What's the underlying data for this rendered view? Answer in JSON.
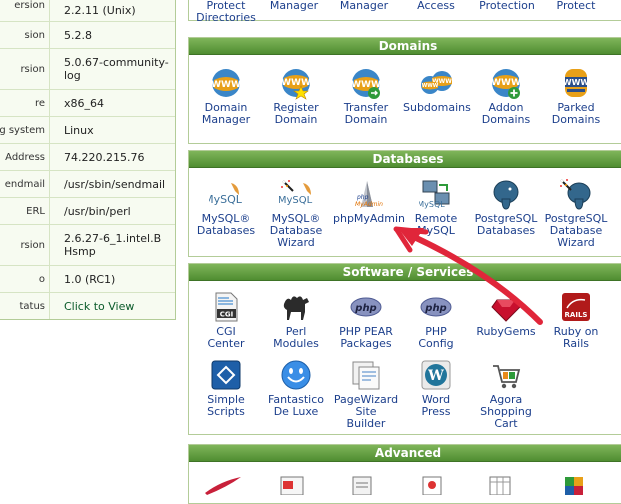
{
  "stats": [
    {
      "label": "ersion",
      "value": "2.2.11 (Unix)"
    },
    {
      "label": "sion",
      "value": "5.2.8"
    },
    {
      "label": "rsion",
      "value": "5.0.67-community-log"
    },
    {
      "label": "re",
      "value": "x86_64"
    },
    {
      "label": "g system",
      "value": "Linux"
    },
    {
      "label": "Address",
      "value": "74.220.215.76"
    },
    {
      "label": "endmail",
      "value": "/usr/sbin/sendmail"
    },
    {
      "label": "ERL",
      "value": "/usr/bin/perl"
    },
    {
      "label": "rsion",
      "value": "2.6.27-6_1.intel.BHsmp"
    },
    {
      "label": "o",
      "value": "1.0 (RC1)"
    },
    {
      "label": "tatus",
      "value": "Click to View"
    }
  ],
  "top_partial": [
    {
      "text": "Protect\nDirectories"
    },
    {
      "text": "Manager"
    },
    {
      "text": "Manager"
    },
    {
      "text": "Access"
    },
    {
      "text": "Protection"
    },
    {
      "text": "Protect"
    }
  ],
  "domains": {
    "title": "Domains",
    "items": [
      {
        "label": "Domain\nManager",
        "icon": "www-globe-icon"
      },
      {
        "label": "Register\nDomain",
        "icon": "www-star-icon"
      },
      {
        "label": "Transfer\nDomain",
        "icon": "www-transfer-icon"
      },
      {
        "label": "Subdomains",
        "icon": "www-sub-icon"
      },
      {
        "label": "Addon\nDomains",
        "icon": "www-add-icon"
      },
      {
        "label": "Parked\nDomains",
        "icon": "www-parked-icon"
      }
    ]
  },
  "databases": {
    "title": "Databases",
    "items": [
      {
        "label": "MySQL®\nDatabases",
        "icon": "mysql-dolphin-icon"
      },
      {
        "label": "MySQL®\nDatabase\nWizard",
        "icon": "mysql-wizard-icon"
      },
      {
        "label": "phpMyAdmin",
        "icon": "phpmyadmin-icon",
        "logo": "php\nMyAdmin"
      },
      {
        "label": "Remote\nMySQL",
        "icon": "remote-mysql-icon"
      },
      {
        "label": "PostgreSQL\nDatabases",
        "icon": "postgresql-elephant-icon"
      },
      {
        "label": "PostgreSQL\nDatabase\nWizard",
        "icon": "postgresql-wizard-icon"
      }
    ]
  },
  "software": {
    "title": "Software / Services",
    "items": [
      {
        "label": "CGI\nCenter",
        "icon": "cgi-icon",
        "logo": "CGI"
      },
      {
        "label": "Perl\nModules",
        "icon": "perl-camel-icon"
      },
      {
        "label": "PHP PEAR\nPackages",
        "icon": "php-pear-icon",
        "logo": "php"
      },
      {
        "label": "PHP\nConfig",
        "icon": "php-config-icon",
        "logo": "php"
      },
      {
        "label": "RubyGems",
        "icon": "rubygems-icon"
      },
      {
        "label": "Ruby on\nRails",
        "icon": "rails-icon",
        "logo": "RAILS"
      },
      {
        "label": "Simple\nScripts",
        "icon": "simple-scripts-icon"
      },
      {
        "label": "Fantastico\nDe Luxe",
        "icon": "fantastico-smiley-icon"
      },
      {
        "label": "PageWizard\nSite\nBuilder",
        "icon": "pagewizard-icon"
      },
      {
        "label": "Word\nPress",
        "icon": "wordpress-icon"
      },
      {
        "label": "Agora\nShopping\nCart",
        "icon": "agora-cart-icon"
      }
    ]
  },
  "advanced": {
    "title": "Advanced"
  },
  "colors": {
    "header_green": "#4f8d31",
    "link_blue": "#1c3f8c",
    "arrow_red": "#e0263a"
  }
}
